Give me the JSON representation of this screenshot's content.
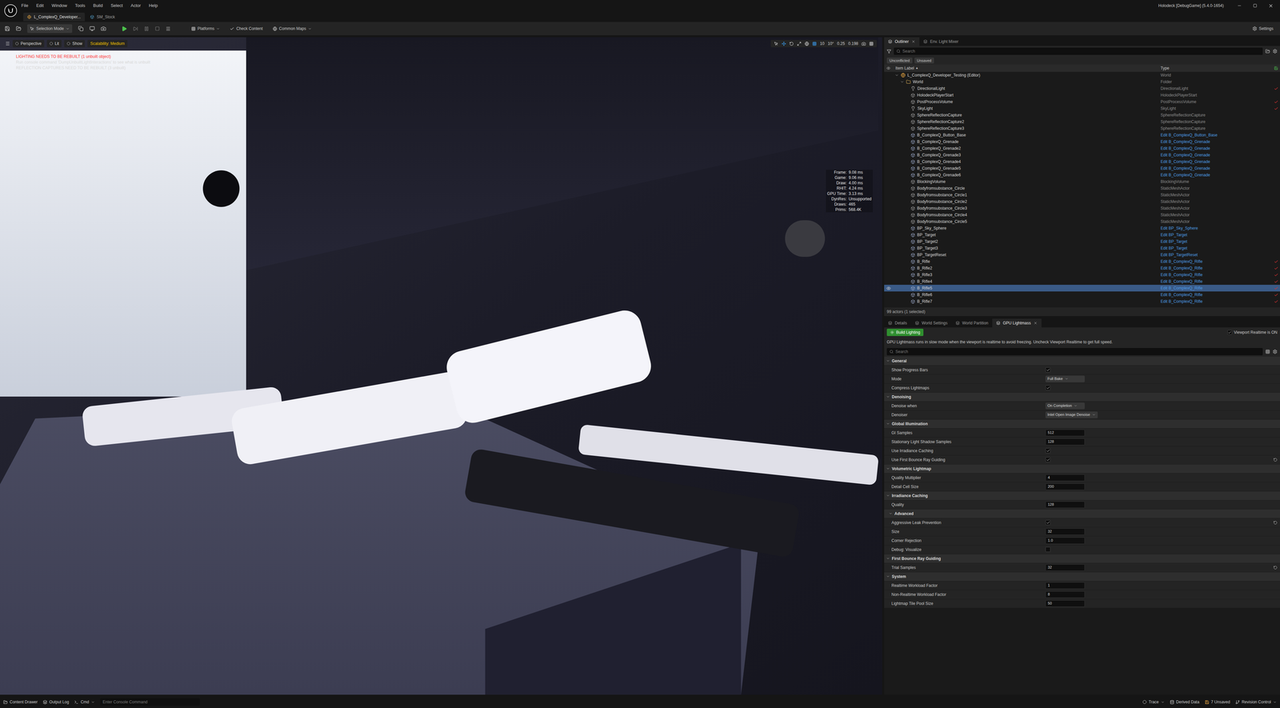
{
  "titlebar": {
    "menus": [
      "File",
      "Edit",
      "Window",
      "Tools",
      "Build",
      "Select",
      "Actor",
      "Help"
    ],
    "documents": [
      {
        "label": "L_ComplexQ_Developer...",
        "selected": true
      },
      {
        "label": "SM_Stock",
        "selected": false
      }
    ],
    "title": "Holodeck [DebugGame] (5.4.0-1654)"
  },
  "toolbar": {
    "mode": "Selection Mode",
    "platforms": "Platforms",
    "check_content": "Check Content",
    "common_maps": "Common Maps",
    "settings": "Settings"
  },
  "viewport": {
    "buttons": [
      {
        "label": "Perspective",
        "warning": false
      },
      {
        "label": "Lit",
        "warning": false
      },
      {
        "label": "Show",
        "warning": false
      },
      {
        "label": "Scalability: Medium",
        "warning": true
      }
    ],
    "snaps": [
      "10",
      "10°",
      "0.25",
      "0.198"
    ],
    "messages": [
      {
        "text": "LIGHTING NEEDS TO BE REBUILT (1 unbuilt object)",
        "color": "#ff3b3b"
      },
      {
        "text": "Run console command 'DumpUnbuiltLightInteractions' to see what is unbuilt",
        "color": "#d8d8d8"
      },
      {
        "text": "REFLECTION CAPTURES NEED TO BE REBUILT (3 unbuilt)",
        "color": "#d8d8d8"
      }
    ],
    "stats": [
      {
        "label": "Frame:",
        "value": "9.08 ms"
      },
      {
        "label": "Game:",
        "value": "9.06 ms"
      },
      {
        "label": "Draw:",
        "value": "4.00 ms"
      },
      {
        "label": "RHIT:",
        "value": "4.24 ms"
      },
      {
        "label": "GPU Time:",
        "value": "3.13 ms"
      },
      {
        "label": "DynRes:",
        "value": "Unsupported"
      },
      {
        "label": "Draws:",
        "value": "465"
      },
      {
        "label": "Prims:",
        "value": "568.4K"
      }
    ]
  },
  "outliner": {
    "tabs": [
      {
        "label": "Outliner",
        "selected": true,
        "closable": true
      },
      {
        "label": "Env. Light Mixer",
        "selected": false,
        "closable": false
      }
    ],
    "search": {
      "placeholder": "Search"
    },
    "filters": [
      "Unconflicted",
      "Unsaved"
    ],
    "columns": {
      "label": "Item Label",
      "sort": "▲",
      "type": "Type"
    },
    "rows": [
      {
        "label": "L_ComplexQ_Developer_Testing (Editor)",
        "type": "World",
        "kind": "level",
        "depth": 0,
        "expanded": true,
        "type_link": false,
        "selected": false,
        "modified": false
      },
      {
        "label": "World",
        "type": "Folder",
        "kind": "folder",
        "depth": 1,
        "expanded": true,
        "type_link": false,
        "selected": false,
        "modified": false
      },
      {
        "label": "DirectionalLight",
        "type": "DirectionalLight",
        "kind": "light",
        "depth": 2,
        "expanded": false,
        "type_link": false,
        "selected": false,
        "modified": true
      },
      {
        "label": "HolodeckPlayerStart",
        "type": "HolodeckPlayerStart",
        "kind": "actor",
        "depth": 2,
        "expanded": false,
        "type_link": false,
        "selected": false,
        "modified": false
      },
      {
        "label": "PostProcessVolume",
        "type": "PostProcessVolume",
        "kind": "actor",
        "depth": 2,
        "expanded": false,
        "type_link": false,
        "selected": false,
        "modified": true
      },
      {
        "label": "SkyLight",
        "type": "SkyLight",
        "kind": "light",
        "depth": 2,
        "expanded": false,
        "type_link": false,
        "selected": false,
        "modified": true
      },
      {
        "label": "SphereReflectionCapture",
        "type": "SphereReflectionCapture",
        "kind": "actor",
        "depth": 2,
        "expanded": false,
        "type_link": false,
        "selected": false,
        "modified": false
      },
      {
        "label": "SphereReflectionCapture2",
        "type": "SphereReflectionCapture",
        "kind": "actor",
        "depth": 2,
        "expanded": false,
        "type_link": false,
        "selected": false,
        "modified": false
      },
      {
        "label": "SphereReflectionCapture3",
        "type": "SphereReflectionCapture",
        "kind": "actor",
        "depth": 2,
        "expanded": false,
        "type_link": false,
        "selected": false,
        "modified": false
      },
      {
        "label": "B_ComplexQ_Button_Base",
        "type": "Edit B_ComplexQ_Button_Base",
        "kind": "blueprint",
        "depth": 2,
        "expanded": false,
        "type_link": true,
        "selected": false,
        "modified": false
      },
      {
        "label": "B_ComplexQ_Grenade",
        "type": "Edit B_ComplexQ_Grenade",
        "kind": "blueprint",
        "depth": 2,
        "expanded": false,
        "type_link": true,
        "selected": false,
        "modified": false
      },
      {
        "label": "B_ComplexQ_Grenade2",
        "type": "Edit B_ComplexQ_Grenade",
        "kind": "blueprint",
        "depth": 2,
        "expanded": false,
        "type_link": true,
        "selected": false,
        "modified": false
      },
      {
        "label": "B_ComplexQ_Grenade3",
        "type": "Edit B_ComplexQ_Grenade",
        "kind": "blueprint",
        "depth": 2,
        "expanded": false,
        "type_link": true,
        "selected": false,
        "modified": false
      },
      {
        "label": "B_ComplexQ_Grenade4",
        "type": "Edit B_ComplexQ_Grenade",
        "kind": "blueprint",
        "depth": 2,
        "expanded": false,
        "type_link": true,
        "selected": false,
        "modified": false
      },
      {
        "label": "B_ComplexQ_Grenade5",
        "type": "Edit B_ComplexQ_Grenade",
        "kind": "blueprint",
        "depth": 2,
        "expanded": false,
        "type_link": true,
        "selected": false,
        "modified": false
      },
      {
        "label": "B_ComplexQ_Grenade6",
        "type": "Edit B_ComplexQ_Grenade",
        "kind": "blueprint",
        "depth": 2,
        "expanded": false,
        "type_link": true,
        "selected": false,
        "modified": false
      },
      {
        "label": "BlockingVolume",
        "type": "BlockingVolume",
        "kind": "actor",
        "depth": 2,
        "expanded": false,
        "type_link": false,
        "selected": false,
        "modified": false
      },
      {
        "label": "Bodyfromsubstance_Circle",
        "type": "StaticMeshActor",
        "kind": "actor",
        "depth": 2,
        "expanded": false,
        "type_link": false,
        "selected": false,
        "modified": false
      },
      {
        "label": "Bodyfromsubstance_Circle1",
        "type": "StaticMeshActor",
        "kind": "actor",
        "depth": 2,
        "expanded": false,
        "type_link": false,
        "selected": false,
        "modified": false
      },
      {
        "label": "Bodyfromsubstance_Circle2",
        "type": "StaticMeshActor",
        "kind": "actor",
        "depth": 2,
        "expanded": false,
        "type_link": false,
        "selected": false,
        "modified": false
      },
      {
        "label": "Bodyfromsubstance_Circle3",
        "type": "StaticMeshActor",
        "kind": "actor",
        "depth": 2,
        "expanded": false,
        "type_link": false,
        "selected": false,
        "modified": false
      },
      {
        "label": "Bodyfromsubstance_Circle4",
        "type": "StaticMeshActor",
        "kind": "actor",
        "depth": 2,
        "expanded": false,
        "type_link": false,
        "selected": false,
        "modified": false
      },
      {
        "label": "Bodyfromsubstance_Circle5",
        "type": "StaticMeshActor",
        "kind": "actor",
        "depth": 2,
        "expanded": false,
        "type_link": false,
        "selected": false,
        "modified": false
      },
      {
        "label": "BP_Sky_Sphere",
        "type": "Edit BP_Sky_Sphere",
        "kind": "blueprint",
        "depth": 2,
        "expanded": false,
        "type_link": true,
        "selected": false,
        "modified": false
      },
      {
        "label": "BP_Target",
        "type": "Edit BP_Target",
        "kind": "blueprint",
        "depth": 2,
        "expanded": false,
        "type_link": true,
        "selected": false,
        "modified": false
      },
      {
        "label": "BP_Target2",
        "type": "Edit BP_Target",
        "kind": "blueprint",
        "depth": 2,
        "expanded": false,
        "type_link": true,
        "selected": false,
        "modified": false
      },
      {
        "label": "BP_Target3",
        "type": "Edit BP_Target",
        "kind": "blueprint",
        "depth": 2,
        "expanded": false,
        "type_link": true,
        "selected": false,
        "modified": false
      },
      {
        "label": "BP_TargetReset",
        "type": "Edit BP_TargetReset",
        "kind": "blueprint",
        "depth": 2,
        "expanded": false,
        "type_link": true,
        "selected": false,
        "modified": false
      },
      {
        "label": "B_Rifle",
        "type": "Edit B_ComplexQ_Rifle",
        "kind": "blueprint",
        "depth": 2,
        "expanded": false,
        "type_link": true,
        "selected": false,
        "modified": true
      },
      {
        "label": "B_Rifle2",
        "type": "Edit B_ComplexQ_Rifle",
        "kind": "blueprint",
        "depth": 2,
        "expanded": false,
        "type_link": true,
        "selected": false,
        "modified": true
      },
      {
        "label": "B_Rifle3",
        "type": "Edit B_ComplexQ_Rifle",
        "kind": "blueprint",
        "depth": 2,
        "expanded": false,
        "type_link": true,
        "selected": false,
        "modified": true
      },
      {
        "label": "B_Rifle4",
        "type": "Edit B_ComplexQ_Rifle",
        "kind": "blueprint",
        "depth": 2,
        "expanded": false,
        "type_link": true,
        "selected": false,
        "modified": true
      },
      {
        "label": "B_Rifle5",
        "type": "Edit B_ComplexQ_Rifle",
        "kind": "blueprint",
        "depth": 2,
        "expanded": false,
        "type_link": true,
        "selected": true,
        "modified": true
      },
      {
        "label": "B_Rifle6",
        "type": "Edit B_ComplexQ_Rifle",
        "kind": "blueprint",
        "depth": 2,
        "expanded": false,
        "type_link": true,
        "selected": false,
        "modified": true
      },
      {
        "label": "B_Rifle7",
        "type": "Edit B_ComplexQ_Rifle",
        "kind": "blueprint",
        "depth": 2,
        "expanded": false,
        "type_link": true,
        "selected": false,
        "modified": true
      }
    ],
    "footer": "99 actors (1 selected)"
  },
  "details": {
    "tabs": [
      {
        "label": "Details",
        "selected": false,
        "closable": false
      },
      {
        "label": "World Settings",
        "selected": false,
        "closable": false
      },
      {
        "label": "World Partition",
        "selected": false,
        "closable": false
      },
      {
        "label": "GPU Lightmass",
        "selected": true,
        "closable": true
      }
    ],
    "build_button": "Build Lighting",
    "realtime": {
      "label": "Viewport Realtime is ON",
      "checked": true
    },
    "info": "GPU Lightmass runs in slow mode when the viewport is realtime to avoid freezing. Uncheck Viewport Realtime to get full speed.",
    "search": {
      "placeholder": "Search"
    },
    "sections": [
      {
        "title": "General",
        "depth": 0,
        "expanded": true,
        "fields": [
          {
            "label": "Show Progress Bars",
            "kind": "checkbox",
            "checked": true,
            "resettable": false
          },
          {
            "label": "Mode",
            "kind": "dropdown",
            "value": "Full Bake",
            "resettable": false
          },
          {
            "label": "Compress Lightmaps",
            "kind": "checkbox",
            "checked": true,
            "resettable": false
          }
        ]
      },
      {
        "title": "Denoising",
        "depth": 0,
        "expanded": true,
        "fields": [
          {
            "label": "Denoise when",
            "kind": "dropdown",
            "value": "On Completion",
            "resettable": false
          },
          {
            "label": "Denoiser",
            "kind": "dropdown",
            "value": "Intel Open Image Denoise",
            "resettable": false
          }
        ]
      },
      {
        "title": "Global Illumination",
        "depth": 0,
        "expanded": true,
        "fields": [
          {
            "label": "GI Samples",
            "kind": "number",
            "value": "512",
            "resettable": false
          },
          {
            "label": "Stationary Light Shadow Samples",
            "kind": "number",
            "value": "128",
            "resettable": false
          },
          {
            "label": "Use Irradiance Caching",
            "kind": "checkbox",
            "checked": true,
            "resettable": false
          },
          {
            "label": "Use First Bounce Ray Guiding",
            "kind": "checkbox",
            "checked": true,
            "resettable": true
          }
        ]
      },
      {
        "title": "Volumetric Lightmap",
        "depth": 0,
        "expanded": true,
        "fields": [
          {
            "label": "Quality Multiplier",
            "kind": "number",
            "value": "4",
            "resettable": false
          },
          {
            "label": "Detail Cell Size",
            "kind": "number",
            "value": "200",
            "resettable": false
          }
        ]
      },
      {
        "title": "Irradiance Caching",
        "depth": 0,
        "expanded": true,
        "fields": [
          {
            "label": "Quality",
            "kind": "number",
            "value": "128",
            "resettable": false
          }
        ]
      },
      {
        "title": "Advanced",
        "depth": 1,
        "expanded": true,
        "fields": [
          {
            "label": "Aggressive Leak Prevention",
            "kind": "checkbox",
            "checked": true,
            "resettable": true
          },
          {
            "label": "Size",
            "kind": "number",
            "value": "32",
            "resettable": false
          },
          {
            "label": "Corner Rejection",
            "kind": "number",
            "value": "1.0",
            "resettable": false
          },
          {
            "label": "Debug: Visualize",
            "kind": "checkbox",
            "checked": false,
            "resettable": false
          }
        ]
      },
      {
        "title": "First Bounce Ray Guiding",
        "depth": 0,
        "expanded": true,
        "fields": [
          {
            "label": "Trial Samples",
            "kind": "number",
            "value": "32",
            "resettable": true
          }
        ]
      },
      {
        "title": "System",
        "depth": 0,
        "expanded": true,
        "fields": [
          {
            "label": "Realtime Workload Factor",
            "kind": "number",
            "value": "1",
            "resettable": false
          },
          {
            "label": "Non-Realtime Workload Factor",
            "kind": "number",
            "value": "8",
            "resettable": false
          },
          {
            "label": "Lightmap Tile Pool Size",
            "kind": "number",
            "value": "50",
            "resettable": false
          }
        ]
      }
    ]
  },
  "status_bar": {
    "left": [
      {
        "label": "Content Drawer"
      },
      {
        "label": "Output Log"
      },
      {
        "label": "Cmd"
      }
    ],
    "console_placeholder": "Enter Console Command",
    "right": [
      {
        "label": "Trace"
      },
      {
        "label": "Derived Data"
      },
      {
        "label": "7 Unsaved"
      },
      {
        "label": "Revision Control"
      }
    ]
  }
}
